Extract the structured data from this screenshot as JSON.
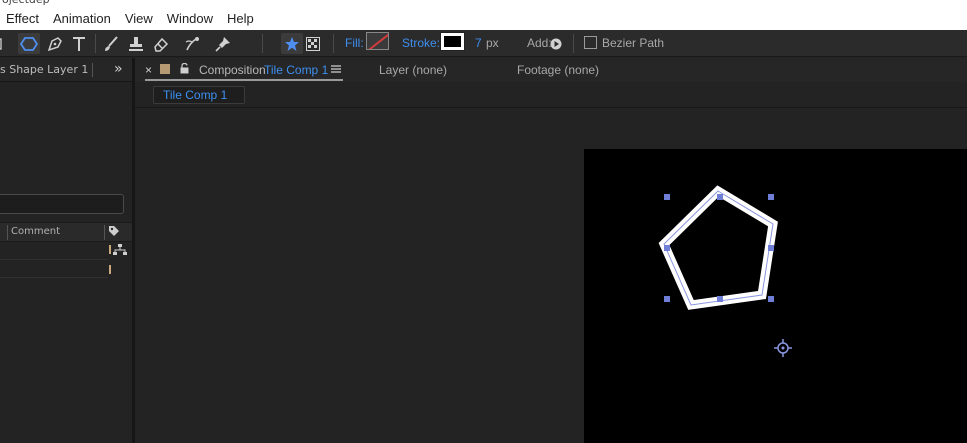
{
  "app": {
    "title_fragment": "ojectdep"
  },
  "menu": [
    "Effect",
    "Animation",
    "View",
    "Window",
    "Help"
  ],
  "toolbar": {
    "fill_label": "Fill:",
    "stroke_label": "Stroke:",
    "stroke_width": "7",
    "stroke_unit": "px",
    "add_label": "Add:",
    "bezier_label": "Bezier Path"
  },
  "left_panel": {
    "tab_text": "s Shape Layer 1",
    "comment_header": "Comment"
  },
  "comp_panel": {
    "composition_prefix": "Composition",
    "composition_name": "Tile Comp 1",
    "layer_tab": "Layer (none)",
    "footage_tab": "Footage (none)",
    "subtab": "Tile Comp 1"
  },
  "colors": {
    "accent": "#3d8ff0",
    "handle": "#6f7fd8",
    "fill_swatch_slash": "#d23b3b"
  }
}
